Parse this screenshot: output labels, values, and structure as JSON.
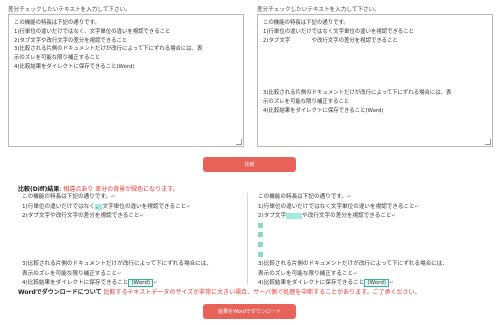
{
  "left_panel": {
    "label": "差分チェックしたいテキストを入力して下さい。",
    "lines": [
      "この機能の特長は下記の通りです。",
      "1)行単位の違いだけではなく、文字単位の違いを視認できること",
      "2)タブ文字や改行文字の差分を視認できること",
      "3)比較される片側のドキュメントだけが改行によって下にずれる場合には、表",
      "示のズレを可能な限り補正すること",
      "4)比較結果をダイレクトに保存できること(Word)",
      "",
      "",
      "",
      "",
      "",
      "",
      "",
      ""
    ]
  },
  "right_panel": {
    "label": "差分チェックしたいテキストを入力して下さい。",
    "lines": [
      "この機能の特長は下記の通りです。",
      "1)行単位の違いだけではなく文字単位の違いを視認できること",
      "2)タブ文字　　　　や改行文字の差分を視認できること",
      "",
      "",
      "",
      "",
      "",
      "3)比較される片側のドキュメントだけが改行によって下にずれる場合には、表",
      "示のズレを可能な限り補正すること",
      "4)比較結果をダイレクトに保存できること(Word)",
      "",
      "",
      ""
    ]
  },
  "compare_button": "比較",
  "result": {
    "label_bold": "比較(Diff)結果",
    "label_colon": ":",
    "label_red": "相違点あり 差分の背景が緑色になります。",
    "left": {
      "l1": "この機能の特長は下記の通りです。",
      "l2_a": "1)行単位の違いだけではなく",
      "l2_b": "、",
      "l2_c": "文字単位の違いを視認できること",
      "l3": "2)タブ文字や改行文字の差分を視認できること",
      "l4": "3)比較される片側のドキュメントだけが改行によって下にずれる場合には、",
      "l5": "表示のズレを可能な限り補正すること",
      "l6_a": "4)比較結果をダイレクトに保存できること",
      "l6_b": "(Word)"
    },
    "right": {
      "l1": "この機能の特長は下記の通りです。",
      "l2": "1)行単位の違いだけではなく文字単位の違いを視認できること",
      "l3_a": "2)タブ文字",
      "l3_b": "や改行文字の差分を視認できること",
      "l4": "3)比較される片側のドキュメントだけが改行によって下にずれる場合には、",
      "l5": "表示のズレを可能な限り補正すること",
      "l6_a": "4)比較結果をダイレクトに保存できること",
      "l6_b": "(Word)"
    },
    "return_mark": "↵"
  },
  "note": {
    "bold": "Wordでダウンロードについて",
    "red": "比較するテキストデータのサイズが非常に大きい場合、サーバ側で処理を中断することがあります。ご了承ください。"
  },
  "download_button": "結果をWordでダウンロード",
  "colors": {
    "accent": "#e9625a",
    "diff_highlight": "#a7e8e0",
    "warning_text": "#e53935"
  }
}
